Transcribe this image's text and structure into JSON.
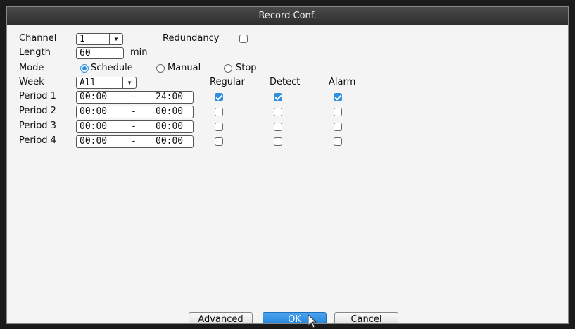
{
  "window": {
    "title": "Record Conf."
  },
  "channel": {
    "label": "Channel",
    "value": "1"
  },
  "redundancy": {
    "label": "Redundancy",
    "checked": false
  },
  "length": {
    "label": "Length",
    "value": "60",
    "unit": "min"
  },
  "mode": {
    "label": "Mode",
    "options": [
      "Schedule",
      "Manual",
      "Stop"
    ],
    "selected": "Schedule"
  },
  "week": {
    "label": "Week",
    "value": "All"
  },
  "columns": {
    "regular": "Regular",
    "detect": "Detect",
    "alarm": "Alarm"
  },
  "periods": [
    {
      "label": "Period 1",
      "start": "00:00",
      "sep": "-",
      "end": "24:00",
      "regular": true,
      "detect": true,
      "alarm": true
    },
    {
      "label": "Period 2",
      "start": "00:00",
      "sep": "-",
      "end": "00:00",
      "regular": false,
      "detect": false,
      "alarm": false
    },
    {
      "label": "Period 3",
      "start": "00:00",
      "sep": "-",
      "end": "00:00",
      "regular": false,
      "detect": false,
      "alarm": false
    },
    {
      "label": "Period 4",
      "start": "00:00",
      "sep": "-",
      "end": "00:00",
      "regular": false,
      "detect": false,
      "alarm": false
    }
  ],
  "buttons": {
    "advanced": "Advanced",
    "ok": "OK",
    "cancel": "Cancel"
  },
  "colors": {
    "accent": "#2f8ee0",
    "titlebar": "#3a3a3a",
    "panel": "#f4f4f4"
  }
}
